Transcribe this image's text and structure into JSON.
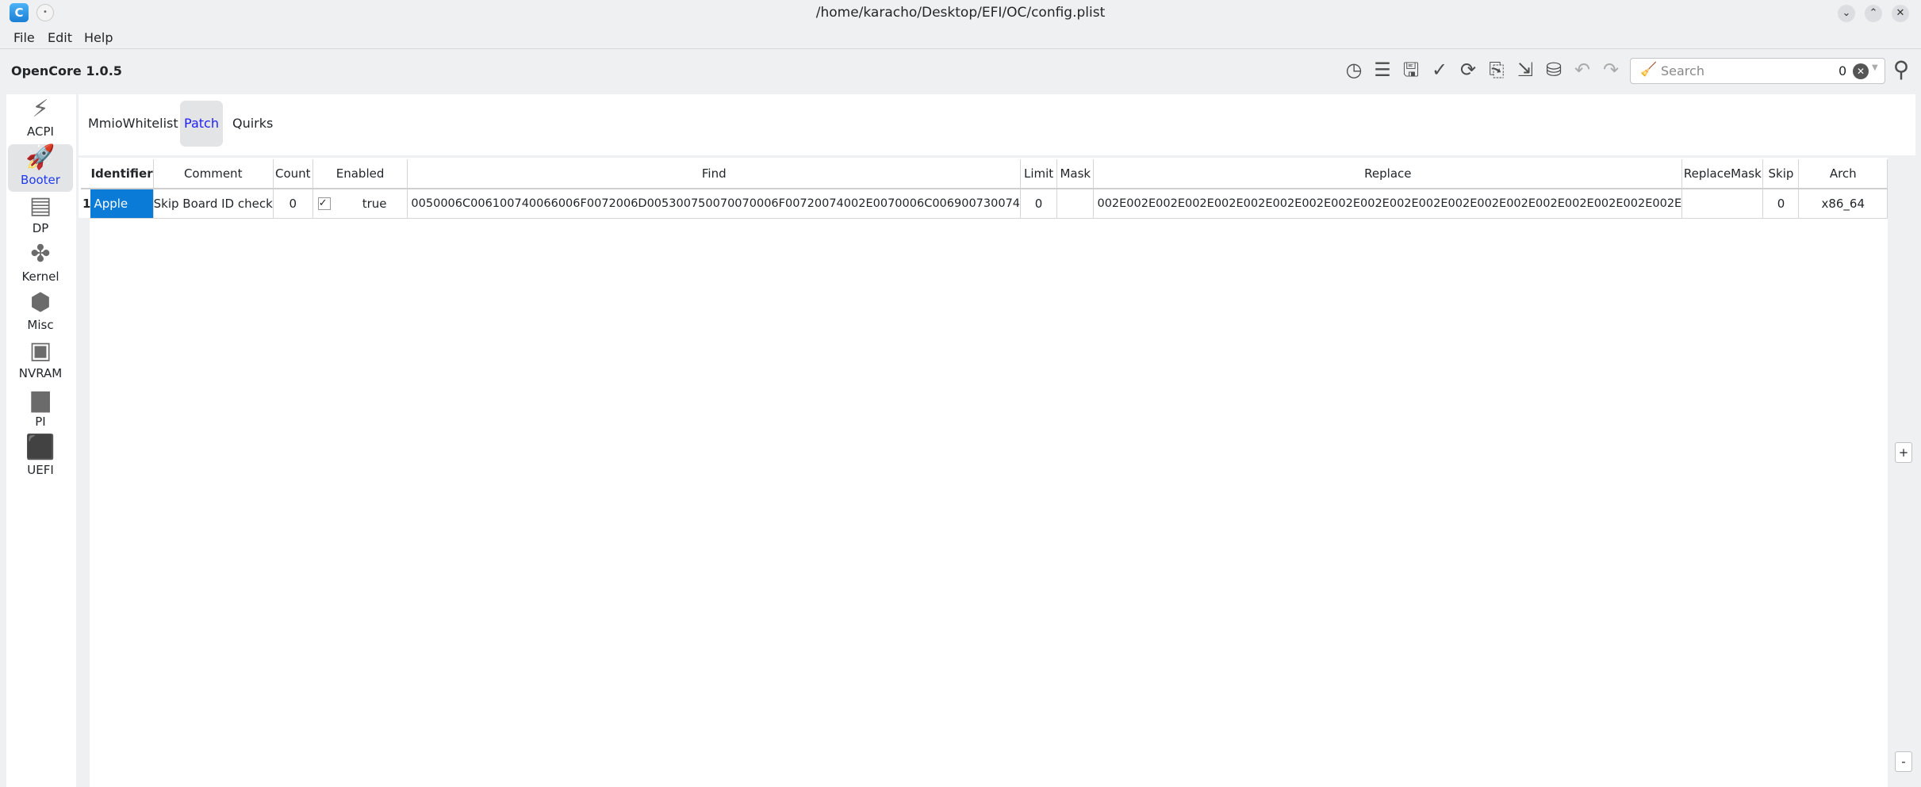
{
  "window": {
    "title": "/home/karacho/Desktop/EFI/OC/config.plist",
    "app_icon": "C"
  },
  "menu": [
    "File",
    "Edit",
    "Help"
  ],
  "version": "OpenCore 1.0.5",
  "search": {
    "placeholder": "Search",
    "count": "0"
  },
  "sidebar": [
    {
      "label": "ACPI",
      "icon": "⚡"
    },
    {
      "label": "Booter",
      "icon": "🚀"
    },
    {
      "label": "DP",
      "icon": "▤"
    },
    {
      "label": "Kernel",
      "icon": "✤"
    },
    {
      "label": "Misc",
      "icon": "⬢"
    },
    {
      "label": "NVRAM",
      "icon": "▣"
    },
    {
      "label": "PI",
      "icon": "▆"
    },
    {
      "label": "UEFI",
      "icon": "⬛"
    }
  ],
  "tabs": [
    "MmioWhitelist",
    "Patch",
    "Quirks"
  ],
  "table": {
    "columns": [
      "Identifier",
      "Comment",
      "Count",
      "Enabled",
      "Find",
      "Limit",
      "Mask",
      "Replace",
      "ReplaceMask",
      "Skip",
      "Arch"
    ],
    "rows": [
      {
        "num": "1",
        "Identifier": "Apple",
        "Comment": "Skip Board ID check",
        "Count": "0",
        "Enabled": "true",
        "Find": "0050006C006100740066006F0072006D005300750070070006F00720074002E0070006C006900730074",
        "Limit": "0",
        "Mask": "",
        "Replace": "002E002E002E002E002E002E002E002E002E002E002E002E002E002E002E002E002E002E002E002E",
        "ReplaceMask": "",
        "Skip": "0",
        "Arch": "x86_64"
      }
    ]
  },
  "buttons": {
    "add": "+",
    "remove": "-"
  },
  "colors": {
    "accent": "#1e3af0",
    "selection": "#0a7bd6"
  }
}
